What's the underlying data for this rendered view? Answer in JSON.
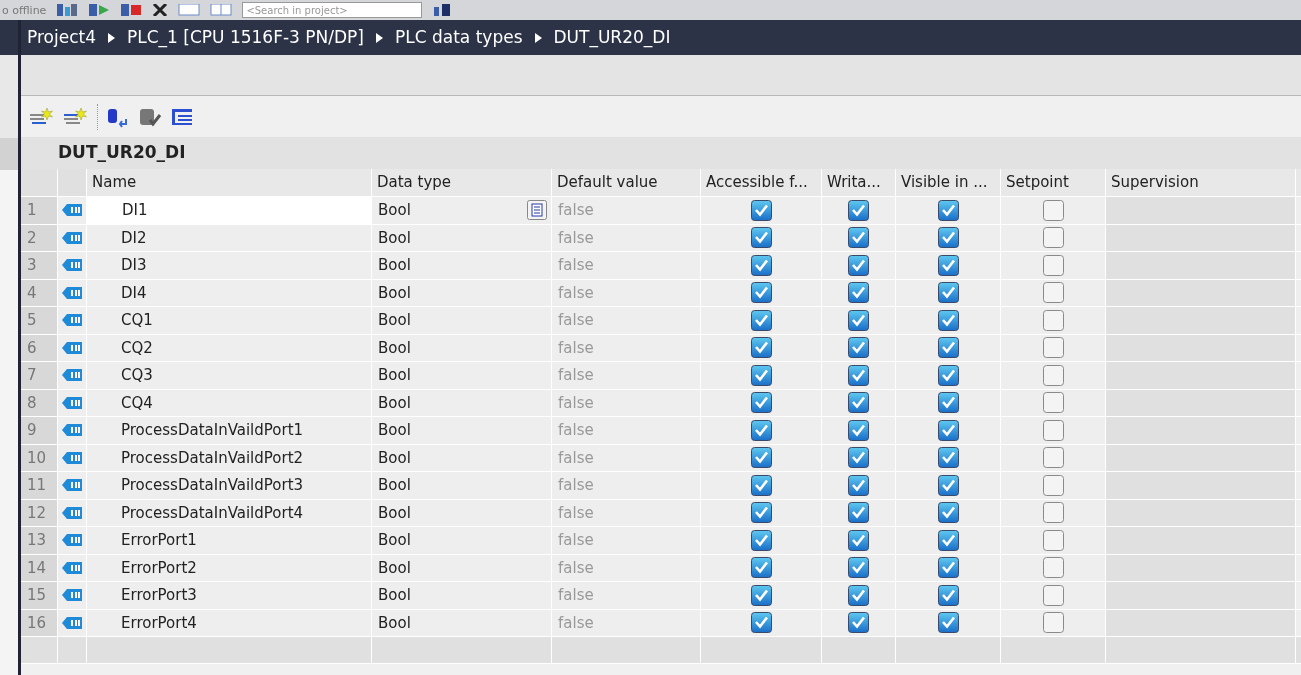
{
  "toolbar": {
    "status_text": "o offline",
    "search": {
      "placeholder": "<Search in project>"
    }
  },
  "breadcrumb": [
    "Project4",
    "PLC_1 [CPU 1516F-3 PN/DP]",
    "PLC data types",
    "DUT_UR20_DI"
  ],
  "editor": {
    "title": "DUT_UR20_DI",
    "columns": [
      "Name",
      "Data type",
      "Default value",
      "Accessible f...",
      "Writa...",
      "Visible in ...",
      "Setpoint",
      "Supervision"
    ],
    "rows": [
      {
        "number": "1",
        "name": "DI1",
        "data_type": "Bool",
        "default_value": "false",
        "accessible": true,
        "writable": true,
        "visible": true,
        "setpoint": false,
        "selected": true
      },
      {
        "number": "2",
        "name": "DI2",
        "data_type": "Bool",
        "default_value": "false",
        "accessible": true,
        "writable": true,
        "visible": true,
        "setpoint": false,
        "selected": false
      },
      {
        "number": "3",
        "name": "DI3",
        "data_type": "Bool",
        "default_value": "false",
        "accessible": true,
        "writable": true,
        "visible": true,
        "setpoint": false,
        "selected": false
      },
      {
        "number": "4",
        "name": "DI4",
        "data_type": "Bool",
        "default_value": "false",
        "accessible": true,
        "writable": true,
        "visible": true,
        "setpoint": false,
        "selected": false
      },
      {
        "number": "5",
        "name": "CQ1",
        "data_type": "Bool",
        "default_value": "false",
        "accessible": true,
        "writable": true,
        "visible": true,
        "setpoint": false,
        "selected": false
      },
      {
        "number": "6",
        "name": "CQ2",
        "data_type": "Bool",
        "default_value": "false",
        "accessible": true,
        "writable": true,
        "visible": true,
        "setpoint": false,
        "selected": false
      },
      {
        "number": "7",
        "name": "CQ3",
        "data_type": "Bool",
        "default_value": "false",
        "accessible": true,
        "writable": true,
        "visible": true,
        "setpoint": false,
        "selected": false
      },
      {
        "number": "8",
        "name": "CQ4",
        "data_type": "Bool",
        "default_value": "false",
        "accessible": true,
        "writable": true,
        "visible": true,
        "setpoint": false,
        "selected": false
      },
      {
        "number": "9",
        "name": "ProcessDataInVaildPort1",
        "data_type": "Bool",
        "default_value": "false",
        "accessible": true,
        "writable": true,
        "visible": true,
        "setpoint": false,
        "selected": false
      },
      {
        "number": "10",
        "name": "ProcessDataInVaildPort2",
        "data_type": "Bool",
        "default_value": "false",
        "accessible": true,
        "writable": true,
        "visible": true,
        "setpoint": false,
        "selected": false
      },
      {
        "number": "11",
        "name": "ProcessDataInVaildPort3",
        "data_type": "Bool",
        "default_value": "false",
        "accessible": true,
        "writable": true,
        "visible": true,
        "setpoint": false,
        "selected": false
      },
      {
        "number": "12",
        "name": "ProcessDataInVaildPort4",
        "data_type": "Bool",
        "default_value": "false",
        "accessible": true,
        "writable": true,
        "visible": true,
        "setpoint": false,
        "selected": false
      },
      {
        "number": "13",
        "name": "ErrorPort1",
        "data_type": "Bool",
        "default_value": "false",
        "accessible": true,
        "writable": true,
        "visible": true,
        "setpoint": false,
        "selected": false
      },
      {
        "number": "14",
        "name": "ErrorPort2",
        "data_type": "Bool",
        "default_value": "false",
        "accessible": true,
        "writable": true,
        "visible": true,
        "setpoint": false,
        "selected": false
      },
      {
        "number": "15",
        "name": "ErrorPort3",
        "data_type": "Bool",
        "default_value": "false",
        "accessible": true,
        "writable": true,
        "visible": true,
        "setpoint": false,
        "selected": false
      },
      {
        "number": "16",
        "name": "ErrorPort4",
        "data_type": "Bool",
        "default_value": "false",
        "accessible": true,
        "writable": true,
        "visible": true,
        "setpoint": false,
        "selected": false
      }
    ]
  }
}
